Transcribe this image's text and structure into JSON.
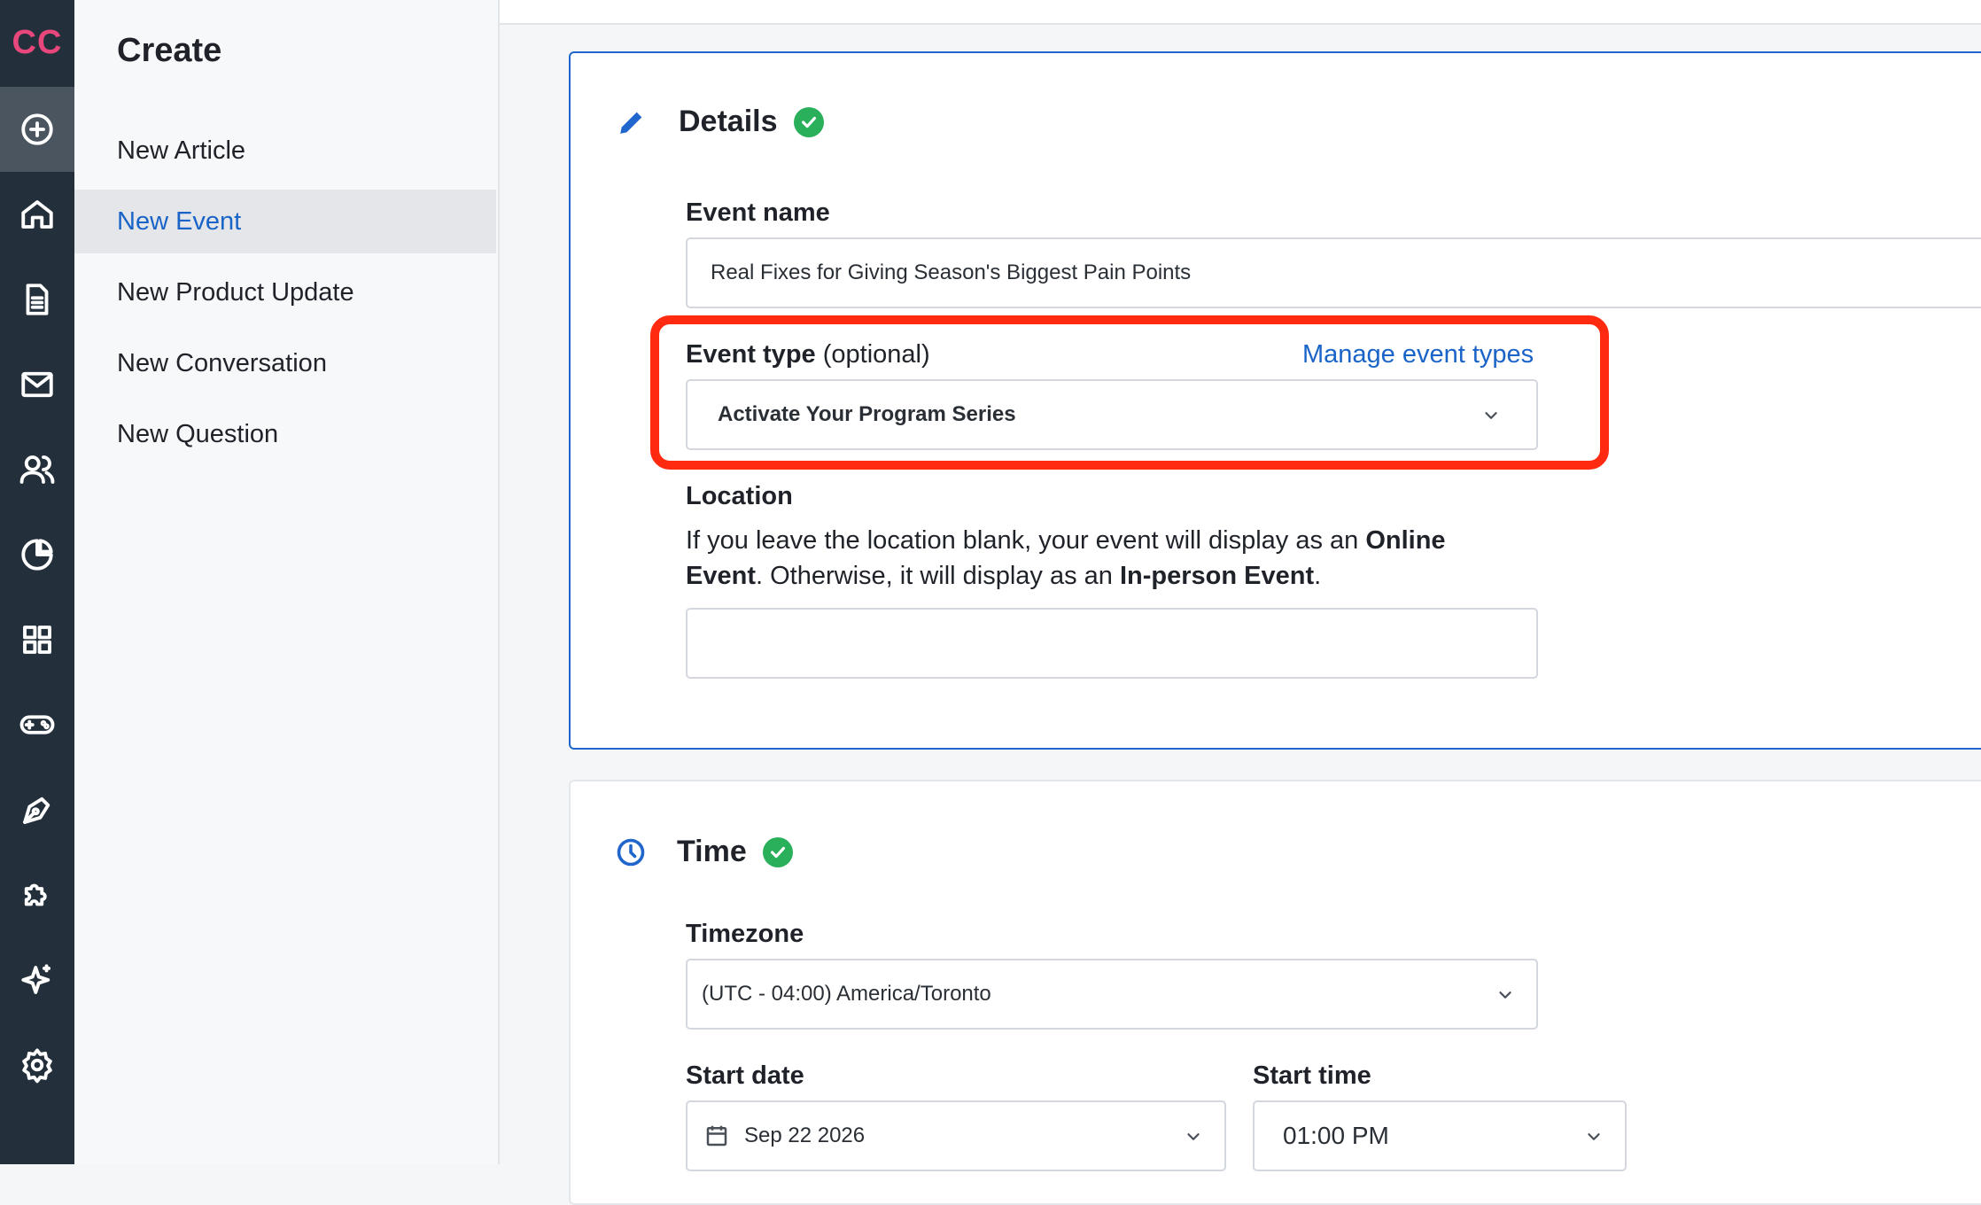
{
  "rail": {
    "logo": "CC",
    "icons": [
      "plus-circle-icon",
      "home-icon",
      "document-icon",
      "mail-icon",
      "people-icon",
      "pie-chart-icon",
      "grid-icon",
      "gamepad-icon",
      "pen-tool-icon",
      "puzzle-icon",
      "sparkle-icon",
      "gear-icon"
    ]
  },
  "menu": {
    "title": "Create",
    "items": [
      {
        "label": "New Article"
      },
      {
        "label": "New Event"
      },
      {
        "label": "New Product Update"
      },
      {
        "label": "New Conversation"
      },
      {
        "label": "New Question"
      }
    ]
  },
  "details": {
    "title": "Details",
    "event_name_label": "Event name",
    "event_name_value": "Real Fixes for Giving Season's Biggest Pain Points",
    "event_type_label": "Event type",
    "event_type_optional": " (optional)",
    "manage_link": "Manage event types",
    "event_type_value": "Activate Your Program Series",
    "location_label": "Location",
    "location_desc_1": "If you leave the location blank, your event will display as an ",
    "location_desc_bold_1": "Online Event",
    "location_desc_2": ". Otherwise, it will display as an ",
    "location_desc_bold_2": "In-person Event",
    "location_desc_3": ".",
    "location_value": ""
  },
  "time": {
    "title": "Time",
    "timezone_label": "Timezone",
    "timezone_value": "(UTC - 04:00) America/Toronto",
    "start_date_label": "Start date",
    "start_date_value": "Sep 22 2026",
    "start_time_label": "Start time",
    "start_time_value": "01:00 PM"
  },
  "colors": {
    "accent": "#1a64c8",
    "highlight": "#ff2a10",
    "success": "#2ab05b",
    "rail": "#23303b"
  }
}
